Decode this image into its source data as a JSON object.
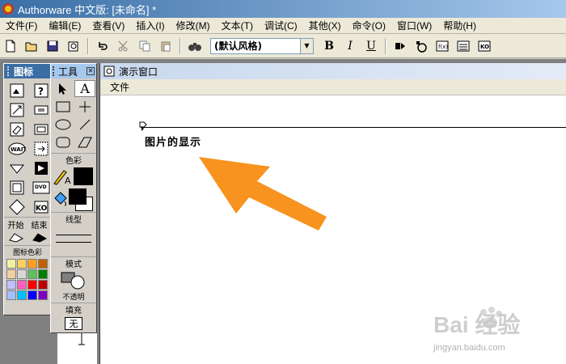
{
  "window": {
    "title": "Authorware 中文版: [未命名] *"
  },
  "menu": [
    {
      "label": "文件(F)"
    },
    {
      "label": "编辑(E)"
    },
    {
      "label": "查看(V)"
    },
    {
      "label": "插入(I)"
    },
    {
      "label": "修改(M)"
    },
    {
      "label": "文本(T)"
    },
    {
      "label": "调试(C)"
    },
    {
      "label": "其他(X)"
    },
    {
      "label": "命令(O)"
    },
    {
      "label": "窗口(W)"
    },
    {
      "label": "帮助(H)"
    }
  ],
  "toolbar": {
    "style_value": "(默认风格)",
    "bold_label": "B",
    "italic_label": "I",
    "underline_label": "U"
  },
  "icon_palette": {
    "title": "图标",
    "start_label": "开始",
    "end_label": "结束",
    "colors_title": "图标色彩",
    "wait_label": "WAIT",
    "dvd_label": "DVD",
    "ko_label": "KO",
    "swatch_colors": [
      "#f0f0a0",
      "#ffd060",
      "#ffa020",
      "#c06000",
      "#f0d0a0",
      "#d8d8d8",
      "#60c060",
      "#008000",
      "#c0c0ff",
      "#ff60c0",
      "#ff0000",
      "#c00000",
      "#a0c0ff",
      "#00c0ff",
      "#0000ff",
      "#8000c0"
    ]
  },
  "tools": {
    "title": "工具",
    "text_tool_label": "A",
    "color_title": "色彩",
    "line_title": "线型",
    "mode_title": "模式",
    "mode_value": "不透明",
    "fill_title": "填充",
    "fill_value": "无"
  },
  "presentation": {
    "title": "演示窗口",
    "menu_file": "文件",
    "canvas_text": "图片的显示"
  },
  "watermark": {
    "brand": "Bai 经验",
    "url": "jingyan.baidu.com"
  },
  "colors": {
    "arrow": "#f7931e",
    "title_active": "#3a6ea5"
  }
}
